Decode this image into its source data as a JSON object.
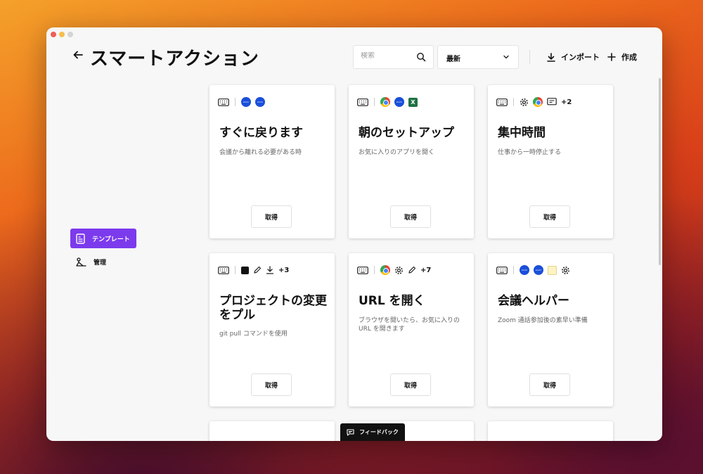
{
  "header": {
    "title": "スマートアクション",
    "search_placeholder": "検索",
    "sort_value": "最新",
    "import_label": "インポート",
    "create_label": "作成"
  },
  "sidebar": {
    "items": [
      {
        "label": "テンプレート",
        "active": true
      },
      {
        "label": "管理",
        "active": false
      }
    ]
  },
  "cards": [
    {
      "title": "すぐに戻ります",
      "description": "会議から離れる必要がある時",
      "get_label": "取得",
      "icons": [
        "keyboard-icon",
        "zoom-icon",
        "zoom-icon"
      ]
    },
    {
      "title": "朝のセットアップ",
      "description": "お気に入りのアプリを開く",
      "get_label": "取得",
      "icons": [
        "keyboard-icon",
        "chrome-icon",
        "zoom-icon",
        "excel-icon"
      ]
    },
    {
      "title": "集中時間",
      "description": "仕事から一時停止する",
      "get_label": "取得",
      "icons": [
        "keyboard-icon",
        "gear-icon",
        "chrome-icon",
        "message-icon"
      ],
      "more": "+2"
    },
    {
      "title": "プロジェクトの変更をプル",
      "description": "git pull コマンドを使用",
      "get_label": "取得",
      "icons": [
        "keyboard-icon",
        "terminal-icon",
        "pencil-icon",
        "download-icon"
      ],
      "more": "+3"
    },
    {
      "title": "URL を開く",
      "description": "ブラウザを開いたら、お気に入りの URL を開きます",
      "get_label": "取得",
      "icons": [
        "keyboard-icon",
        "chrome-icon",
        "gear-icon",
        "pencil-icon"
      ],
      "more": "+7"
    },
    {
      "title": "会議ヘルパー",
      "description": "Zoom 通話参加後の素早い準備",
      "get_label": "取得",
      "icons": [
        "keyboard-icon",
        "zoom-icon",
        "zoom-icon",
        "notes-icon",
        "gear-icon"
      ]
    }
  ],
  "zoom_text": "zoom",
  "excel_text": "X",
  "feedback_label": "フィードバック",
  "colors": {
    "accent": "#7c3aed",
    "zoom": "#1a4fd8",
    "excel": "#1f7244"
  }
}
